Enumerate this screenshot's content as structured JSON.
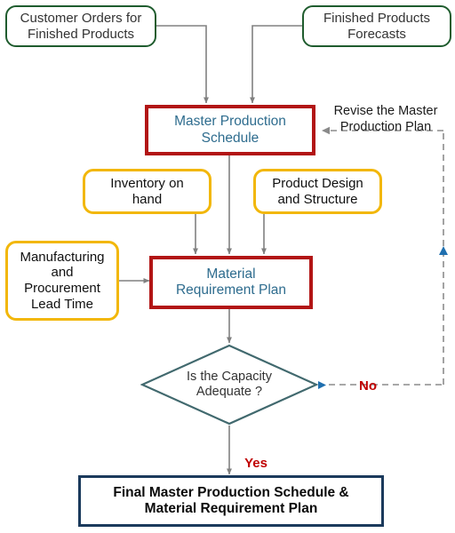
{
  "diagram": {
    "title": "Master Production Schedule and Material Requirement Planning Flow",
    "colors": {
      "source_border": "#1F5C2E",
      "process_border": "#B21515",
      "process_text": "#2E6C8E",
      "input_border": "#F2B70A",
      "terminal_border": "#1B3A5C",
      "decision_border": "#41696E",
      "branch_label": "#C00000",
      "solid_connector": "#808080",
      "dashed_connector": "#8C8C8C",
      "feedback_arrowhead": "#1F6FAF"
    },
    "nodes": {
      "customer_orders": {
        "label": "Customer Orders for\nFinished Products",
        "type": "source"
      },
      "product_forecasts": {
        "label": "Finished Products\nForecasts",
        "type": "source"
      },
      "master_production_schedule": {
        "label": "Master Production\nSchedule",
        "type": "process"
      },
      "inventory_on_hand": {
        "label": "Inventory on\nhand",
        "type": "input"
      },
      "product_design": {
        "label": "Product Design\nand Structure",
        "type": "input"
      },
      "lead_time": {
        "label": "Manufacturing\nand\nProcurement\nLead Time",
        "type": "input"
      },
      "material_requirement_plan": {
        "label": "Material\nRequirement Plan",
        "type": "process"
      },
      "capacity_decision": {
        "label": "Is the Capacity\nAdequate ?",
        "type": "decision"
      },
      "final_plan": {
        "label": "Final Master Production Schedule &\nMaterial Requirement Plan",
        "type": "terminal"
      }
    },
    "edge_labels": {
      "revise": "Revise the Master\nProduction Plan",
      "no": "No",
      "yes": "Yes"
    }
  }
}
